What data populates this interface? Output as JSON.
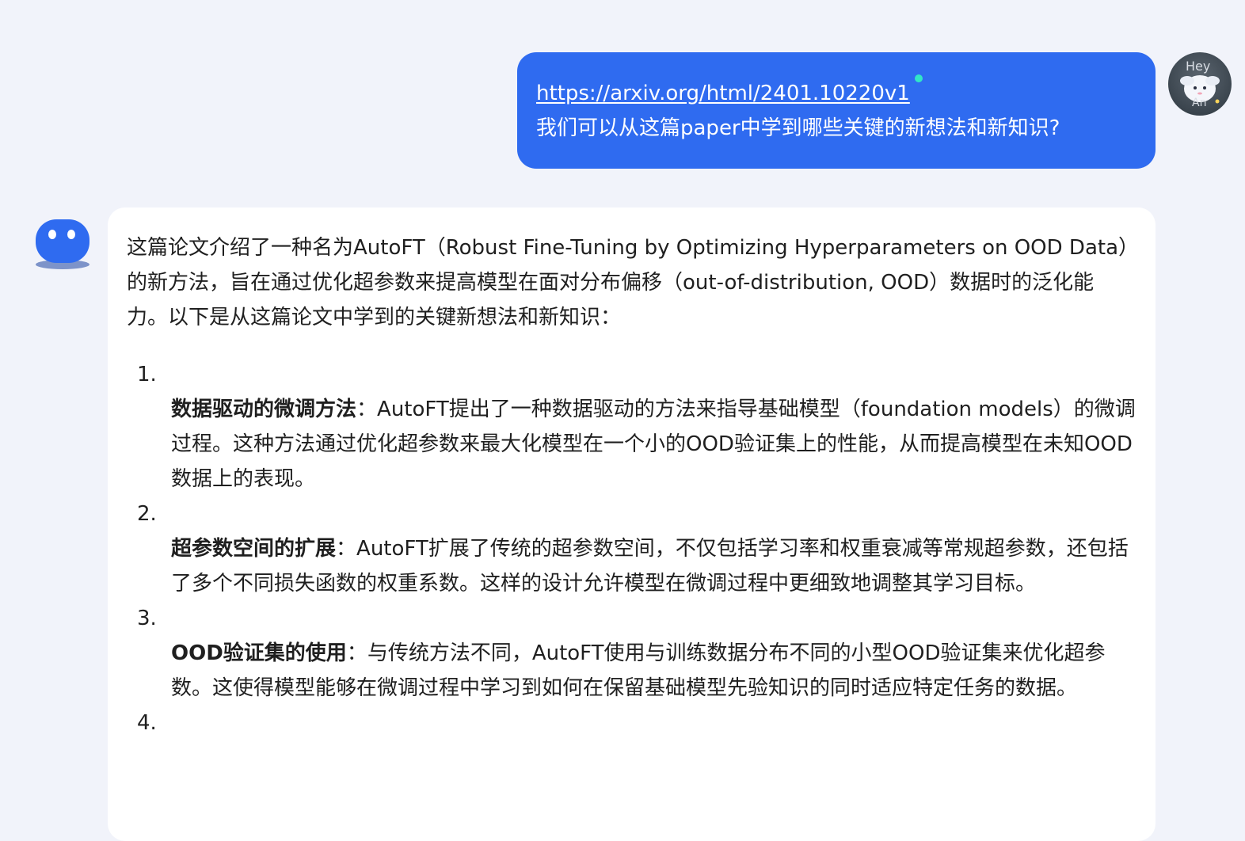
{
  "user_message": {
    "link": "https://arxiv.org/html/2401.10220v1",
    "question": "我们可以从这篇paper中学到哪些关键的新想法和新知识?",
    "avatar_text_top": "Hey",
    "avatar_text_bottom": "An",
    "link_dot_color": "#31e7c6",
    "bubble_color": "#2f6bf0"
  },
  "assistant_message": {
    "intro": "这篇论文介绍了一种名为AutoFT（Robust Fine-Tuning by Optimizing Hyperparameters on OOD Data）的新方法，旨在通过优化超参数来提高模型在面对分布偏移（out-of-distribution, OOD）数据时的泛化能力。以下是从这篇论文中学到的关键新想法和新知识：",
    "items": [
      {
        "num": "1.",
        "title": "数据驱动的微调方法",
        "sep": "：",
        "text": "AutoFT提出了一种数据驱动的方法来指导基础模型（foundation models）的微调过程。这种方法通过优化超参数来最大化模型在一个小的OOD验证集上的性能，从而提高模型在未知OOD数据上的表现。"
      },
      {
        "num": "2.",
        "title": "超参数空间的扩展",
        "sep": "：",
        "text": "AutoFT扩展了传统的超参数空间，不仅包括学习率和权重衰减等常规超参数，还包括了多个不同损失函数的权重系数。这样的设计允许模型在微调过程中更细致地调整其学习目标。"
      },
      {
        "num": "3.",
        "title": "OOD验证集的使用",
        "sep": "：",
        "text": "与传统方法不同，AutoFT使用与训练数据分布不同的小型OOD验证集来优化超参数。这使得模型能够在微调过程中学习到如何在保留基础模型先验知识的同时适应特定任务的数据。"
      },
      {
        "num": "4.",
        "title": "",
        "sep": "",
        "text": ""
      }
    ]
  }
}
